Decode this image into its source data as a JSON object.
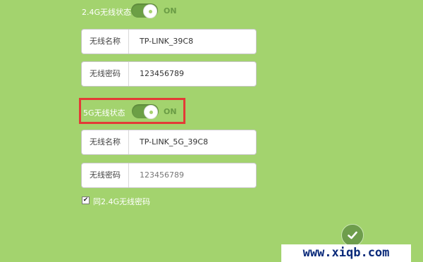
{
  "wifi24": {
    "label": "2.4G无线状态",
    "status": "ON"
  },
  "wifi24_name": {
    "label": "无线名称",
    "value": "TP-LINK_39C8"
  },
  "wifi24_pwd": {
    "label": "无线密码",
    "value": "123456789"
  },
  "wifi5": {
    "label": "5G无线状态",
    "status": "ON"
  },
  "wifi5_name": {
    "label": "无线名称",
    "value": "TP-LINK_5G_39C8"
  },
  "wifi5_pwd": {
    "label": "无线密码",
    "value": "123456789"
  },
  "same_pwd": {
    "label": "同2.4G无线密码",
    "checked": true,
    "mark": "✔"
  },
  "watermark": "www.xiqb.com",
  "colors": {
    "background": "#a3d36e",
    "toggle_on": "#6c9f45",
    "highlight": "#e33b36"
  },
  "icons": {
    "confirm": "checkmark-icon"
  }
}
